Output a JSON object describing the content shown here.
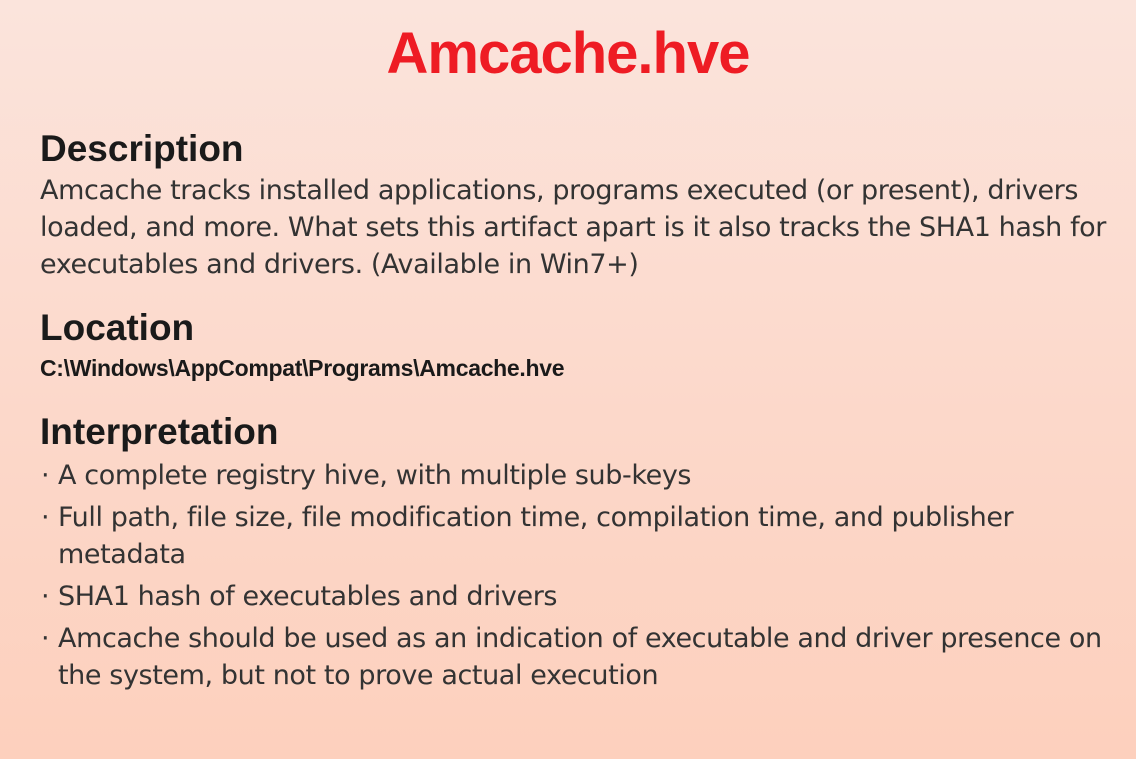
{
  "page": {
    "title": "Amcache.hve",
    "title_color": "#ee1c24",
    "background": "#fcdcd0"
  },
  "description": {
    "heading": "Description",
    "text": "Amcache tracks installed applications, programs executed (or present), drivers loaded, and more. What sets this artifact apart is it also tracks the SHA1 hash for executables and drivers. (Available in Win7+)"
  },
  "location": {
    "heading": "Location",
    "path": "C:\\Windows\\AppCompat\\Programs\\Amcache.hve"
  },
  "interpretation": {
    "heading": "Interpretation",
    "bullet_glyph": "·",
    "items": [
      "A complete registry hive, with multiple sub-keys",
      "Full path, file size, file modification time, compilation time, and publisher metadata",
      "SHA1 hash of executables and drivers",
      "Amcache should be used as an indication of executable and driver presence on the system, but not to prove actual execution"
    ]
  }
}
